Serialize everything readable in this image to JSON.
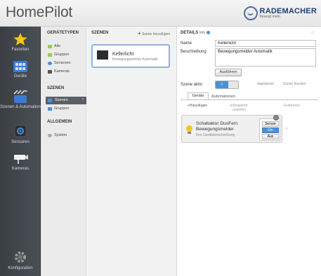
{
  "header": {
    "app_title": "HomePilot",
    "brand": "RADEMACHER",
    "brand_sub": "Bewegt mehr."
  },
  "sidebar": {
    "items": [
      {
        "label": "Favoriten",
        "icon": "star-icon"
      },
      {
        "label": "Geräte",
        "icon": "device-grid-icon"
      },
      {
        "label": "Szenen & Automation",
        "icon": "scene-icon"
      },
      {
        "label": "Sensoren",
        "icon": "sensor-icon"
      },
      {
        "label": "Kameras",
        "icon": "camera-icon"
      },
      {
        "label": "Konfiguration",
        "icon": "gear-icon"
      }
    ]
  },
  "types": {
    "title": "GERÄTETYPEN",
    "items": [
      {
        "label": "Alle",
        "color": "#9c5"
      },
      {
        "label": "Gruppen",
        "color": "#9c5"
      },
      {
        "label": "Sensoren",
        "color": "#4a90d9"
      },
      {
        "label": "Kameras",
        "color": "#555"
      }
    ],
    "scenes_title": "SZENEN",
    "scenes_items": [
      "Szenen",
      "Gruppen"
    ],
    "general_title": "ALLGEMEIN",
    "general_items": [
      "System"
    ]
  },
  "scenes": {
    "title": "SZENEN",
    "add_label": "Szene hinzufügen",
    "card": {
      "name": "Kellerlicht",
      "description": "Bewegungsmelder Automatik"
    }
  },
  "details": {
    "title": "DETAILS",
    "info": "Info",
    "name_label": "Name",
    "name_value": "Kellerlicht",
    "desc_label": "Beschreibung",
    "desc_value": "Bewegungsmelder Automatik",
    "execute_label": "Ausführen",
    "active_label": "Szene aktiv",
    "toggle_on": "I",
    "duplicate_label": "duplizieren",
    "delete_label": "Szene löschen",
    "tabs": [
      "Geräte",
      "Automationen"
    ],
    "toolbar": {
      "add": "Hinzufügen",
      "snapshot": "Snapshot erstellen",
      "remove": "Entfernen"
    },
    "device": {
      "name": "Schaltaktor DuoFern Bewegungsmelder",
      "description": "Ihre Gerätebeschreibung",
      "buttons": [
        "Sensor",
        "Ein",
        "Aus"
      ],
      "selected": "Ein"
    }
  }
}
